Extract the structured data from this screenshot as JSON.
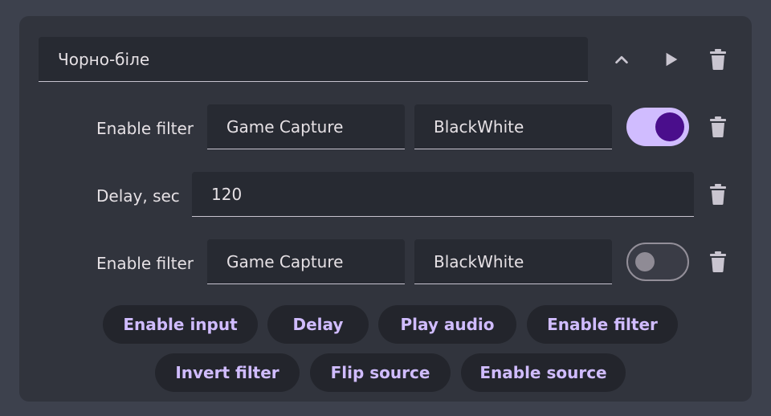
{
  "header": {
    "name_value": "Чорно-біле"
  },
  "rows": [
    {
      "label": "Enable filter",
      "source": "Game Capture",
      "filter": "BlackWhite",
      "enabled": true
    },
    {
      "label": "Delay, sec",
      "value": "120"
    },
    {
      "label": "Enable filter",
      "source": "Game Capture",
      "filter": "BlackWhite",
      "enabled": false
    }
  ],
  "actions": {
    "row1": [
      "Enable input",
      "Delay",
      "Play audio",
      "Enable filter"
    ],
    "row2": [
      "Invert filter",
      "Flip source",
      "Enable source"
    ]
  },
  "icons": {
    "move_up": "chevron-up-icon",
    "run": "play-icon",
    "delete": "trash-icon"
  },
  "colors": {
    "background": "#3d414d",
    "card": "#31343d",
    "field": "#272a32",
    "accent": "#d0bcff",
    "accent_dark": "#4a0e8c",
    "chip_bg": "#23252c"
  }
}
